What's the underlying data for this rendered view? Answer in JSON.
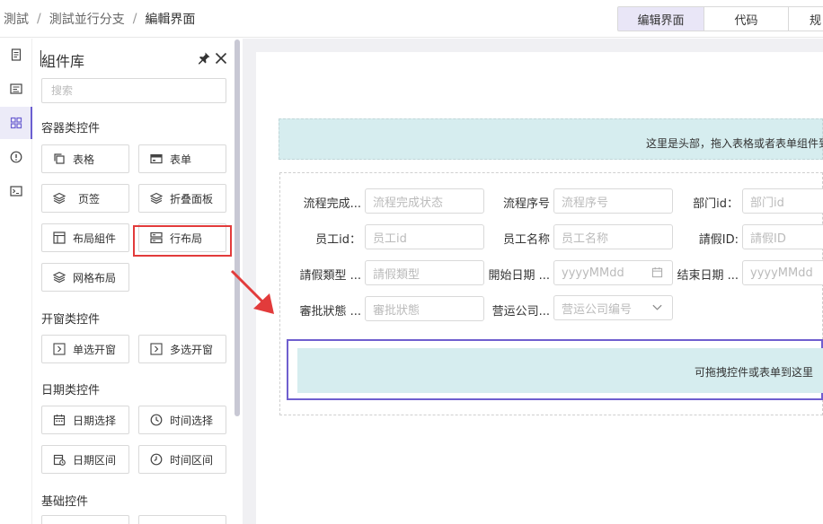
{
  "breadcrumb": [
    "測試",
    "測試並行分支",
    "編輯界面"
  ],
  "tabs": [
    {
      "label": "编辑界面",
      "active": true
    },
    {
      "label": "代码",
      "active": false
    },
    {
      "label": "规",
      "active": false
    }
  ],
  "rail": {
    "icons": [
      "page-icon",
      "form-list-icon",
      "grid-icon",
      "alert-icon",
      "terminal-icon"
    ],
    "active_index": 2,
    "accent": "#6b5fd1"
  },
  "panel": {
    "title": "組件库",
    "search_placeholder": "搜索",
    "sections": [
      {
        "title": "容器类控件",
        "items": [
          "表格",
          "表单",
          "页签",
          "折叠面板",
          "布局組件",
          "行布局",
          "网格布局"
        ]
      },
      {
        "title": "开窗类控件",
        "items": [
          "单选开窗",
          "多选开窗"
        ]
      },
      {
        "title": "日期类控件",
        "items": [
          "日期选择",
          "时间选择",
          "日期区间",
          "时间区间"
        ]
      },
      {
        "title": "基础控件",
        "items": []
      }
    ],
    "highlighted_item": "行布局"
  },
  "canvas": {
    "header_hint": "这里是头部，拖入表格或者表单组件到",
    "drop_hint": "可拖拽控件或表单到这里",
    "form_rows": [
      [
        {
          "label": "流程完成...",
          "placeholder": "流程完成状态"
        },
        {
          "label": "流程序号",
          "placeholder": "流程序号"
        },
        {
          "label": "部门id：",
          "placeholder": "部门id"
        }
      ],
      [
        {
          "label": "员工id：",
          "placeholder": "员工id"
        },
        {
          "label": "员工名称",
          "placeholder": "员工名称"
        },
        {
          "label": "請假ID:",
          "placeholder": "請假ID"
        }
      ],
      [
        {
          "label": "請假類型 ...",
          "placeholder": "請假類型"
        },
        {
          "label": "開始日期 ...",
          "placeholder": "yyyyMMdd"
        },
        {
          "label": "结束日期 ...",
          "placeholder": "yyyyMMdd"
        }
      ],
      [
        {
          "label": "審批狀態 ...",
          "placeholder": "審批狀態"
        },
        {
          "label": "营运公司...",
          "placeholder": "营运公司编号"
        }
      ]
    ]
  }
}
